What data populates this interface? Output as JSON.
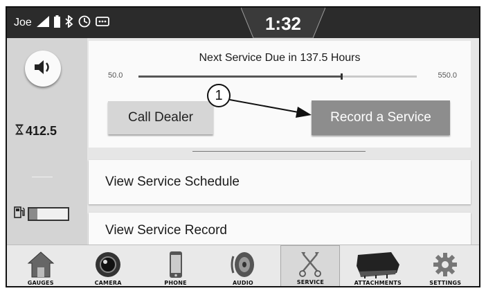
{
  "status_bar": {
    "user": "Joe",
    "clock": "1:32",
    "icons": [
      "signal-icon",
      "battery-icon",
      "bluetooth-icon",
      "clock-icon",
      "message-icon"
    ]
  },
  "left_rail": {
    "hours_icon": "hourglass-icon",
    "hours_value": "412.5",
    "fuel_icon": "fuel-pump-icon",
    "fuel_level": 0.22
  },
  "service": {
    "title": "Next Service Due in 137.5 Hours",
    "range_min": "50.0",
    "range_max": "550.0",
    "progress_fraction": 0.73,
    "call_dealer_label": "Call Dealer",
    "record_service_label": "Record a Service",
    "callout": "1"
  },
  "list": {
    "items": [
      {
        "label": "View Service Schedule"
      },
      {
        "label": "View Service Record"
      }
    ]
  },
  "nav": {
    "items": [
      {
        "label": "GAUGES",
        "icon": "house-icon"
      },
      {
        "label": "CAMERA",
        "icon": "camera-icon"
      },
      {
        "label": "PHONE",
        "icon": "phone-icon"
      },
      {
        "label": "AUDIO",
        "icon": "speaker-icon"
      },
      {
        "label": "SERVICE",
        "icon": "wrench-screwdriver-icon",
        "active": true
      },
      {
        "label": "ATTACHMENTS",
        "icon": "bucket-icon"
      },
      {
        "label": "SETTINGS",
        "icon": "gear-icon"
      }
    ]
  },
  "colors": {
    "status_bar": "#2b2b2b",
    "rail": "#d4d4d4",
    "card": "#fafafa",
    "primary_button": "#8d8d8d",
    "secondary_button": "#d6d6d6"
  }
}
